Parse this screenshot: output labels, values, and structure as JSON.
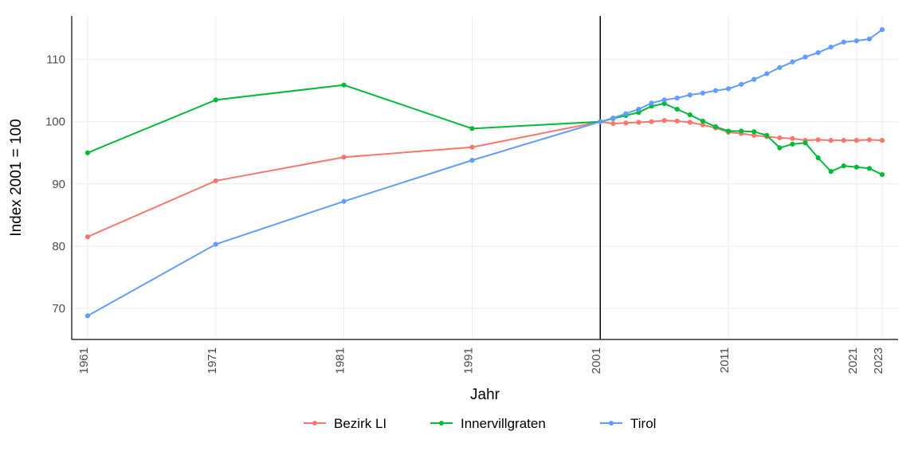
{
  "chart_data": {
    "type": "line",
    "xlabel": "Jahr",
    "ylabel": "Index 2001 = 100",
    "ylim": [
      65,
      117
    ],
    "y_ticks": [
      70,
      80,
      90,
      100,
      110
    ],
    "x_ticks": [
      1961,
      1971,
      1981,
      1991,
      2001,
      2011,
      2021,
      2023
    ],
    "reference_x": 2001,
    "legend_position": "bottom",
    "series": [
      {
        "name": "Bezirk LI",
        "color": "#f8766d",
        "x": [
          1961,
          1971,
          1981,
          1991,
          2001,
          2002,
          2003,
          2004,
          2005,
          2006,
          2007,
          2008,
          2009,
          2010,
          2011,
          2012,
          2013,
          2014,
          2015,
          2016,
          2017,
          2018,
          2019,
          2020,
          2021,
          2022,
          2023
        ],
        "y": [
          81.5,
          90.5,
          94.3,
          95.9,
          100.0,
          99.7,
          99.8,
          99.9,
          100.0,
          100.2,
          100.1,
          99.9,
          99.5,
          99.0,
          98.3,
          98.1,
          97.8,
          97.6,
          97.4,
          97.3,
          97.0,
          97.1,
          97.0,
          97.0,
          97.0,
          97.1,
          97.0
        ]
      },
      {
        "name": "Innervillgraten",
        "color": "#00ba38",
        "x": [
          1961,
          1971,
          1981,
          1991,
          2001,
          2002,
          2003,
          2004,
          2005,
          2006,
          2007,
          2008,
          2009,
          2010,
          2011,
          2012,
          2013,
          2014,
          2015,
          2016,
          2017,
          2018,
          2019,
          2020,
          2021,
          2022,
          2023
        ],
        "y": [
          95.0,
          103.5,
          105.9,
          98.9,
          100.0,
          100.5,
          101.0,
          101.5,
          102.5,
          102.9,
          102.0,
          101.1,
          100.1,
          99.2,
          98.5,
          98.5,
          98.4,
          97.8,
          95.8,
          96.4,
          96.6,
          94.2,
          92.0,
          92.9,
          92.7,
          92.5,
          91.5
        ]
      },
      {
        "name": "Tirol",
        "color": "#619cff",
        "x": [
          1961,
          1971,
          1981,
          1991,
          2001,
          2002,
          2003,
          2004,
          2005,
          2006,
          2007,
          2008,
          2009,
          2010,
          2011,
          2012,
          2013,
          2014,
          2015,
          2016,
          2017,
          2018,
          2019,
          2020,
          2021,
          2022,
          2023
        ],
        "y": [
          68.8,
          80.3,
          87.2,
          93.8,
          100.0,
          100.6,
          101.3,
          102.0,
          103.0,
          103.5,
          103.8,
          104.3,
          104.6,
          105.0,
          105.3,
          106.0,
          106.8,
          107.7,
          108.7,
          109.6,
          110.4,
          111.1,
          112.0,
          112.8,
          113.0,
          113.3,
          114.8
        ]
      }
    ]
  }
}
